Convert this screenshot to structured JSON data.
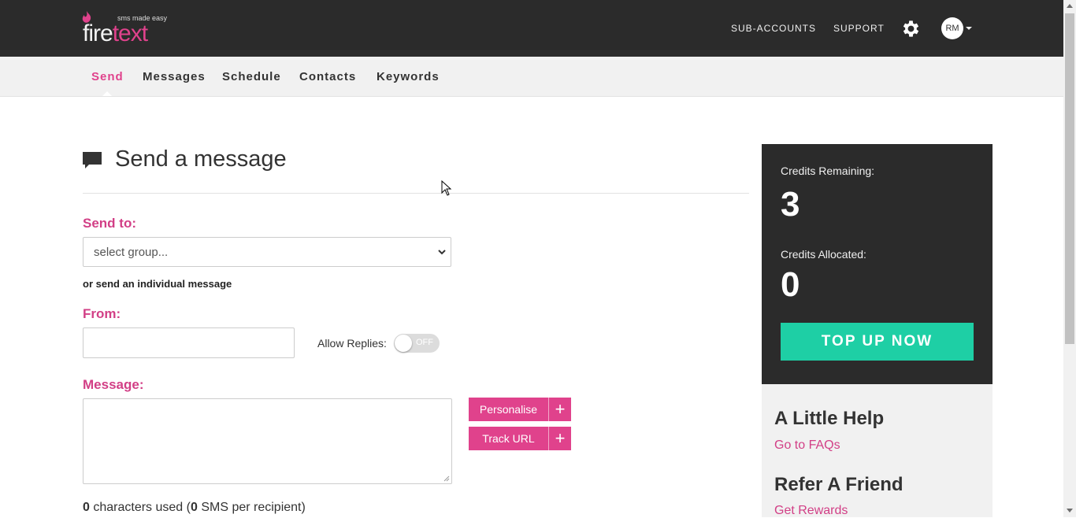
{
  "brand": {
    "logo_fire": "fire",
    "logo_text": "text",
    "tagline": "sms made easy",
    "accent": "#e0428c",
    "teal": "#1ecfa5"
  },
  "header": {
    "links": [
      "SUB-ACCOUNTS",
      "SUPPORT"
    ],
    "settings_icon": "gear-icon",
    "avatar_initials": "RM"
  },
  "subnav": {
    "items": [
      "Send",
      "Messages",
      "Schedule",
      "Contacts",
      "Keywords"
    ],
    "active": "Send"
  },
  "main": {
    "title": "Send a message",
    "title_icon": "speech-bubble-icon",
    "send_to_label": "Send to:",
    "select_value": "select group...",
    "individual_link": "or send an individual message",
    "from_label": "From:",
    "from_value": "",
    "allow_replies_label": "Allow Replies:",
    "allow_replies_state": "OFF",
    "message_label": "Message:",
    "message_value": "",
    "personalise_label": "Personalise",
    "track_url_label": "Track URL",
    "plus_symbol": "+",
    "chars_count": "0",
    "chars_text": " characters used (",
    "sms_count": "0",
    "sms_text": " SMS per recipient)"
  },
  "credits": {
    "remaining_label": "Credits Remaining:",
    "remaining_value": "3",
    "allocated_label": "Credits Allocated:",
    "allocated_value": "0",
    "topup_label": "TOP UP NOW"
  },
  "help": {
    "heading1": "A Little Help",
    "link1": "Go to FAQs",
    "heading2": "Refer A Friend",
    "link2": "Get Rewards"
  }
}
